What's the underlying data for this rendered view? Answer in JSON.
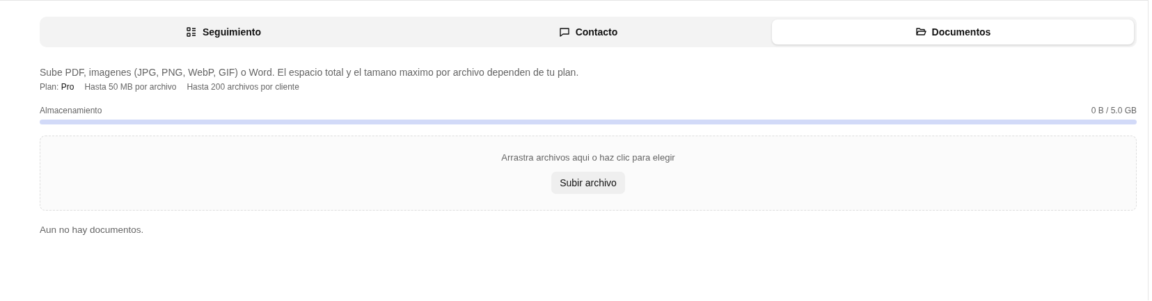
{
  "tabs": [
    {
      "label": "Seguimiento",
      "selected": false
    },
    {
      "label": "Contacto",
      "selected": false
    },
    {
      "label": "Documentos",
      "selected": true
    }
  ],
  "description": "Sube PDF, imagenes (JPG, PNG, WebP, GIF) o Word. El espacio total y el tamano maximo por archivo dependen de tu plan.",
  "plan": {
    "label": "Plan:",
    "value": "Pro",
    "limits": [
      "Hasta 50 MB por archivo",
      "Hasta 200 archivos por cliente"
    ]
  },
  "storage": {
    "label": "Almacenamiento",
    "reading": "0 B / 5.0 GB",
    "level": 0
  },
  "dropzone": {
    "hint": "Arrastra archivos aqui o haz clic para elegir",
    "button": "Subir archivo"
  },
  "empty_message": "Aun no hay documentos."
}
